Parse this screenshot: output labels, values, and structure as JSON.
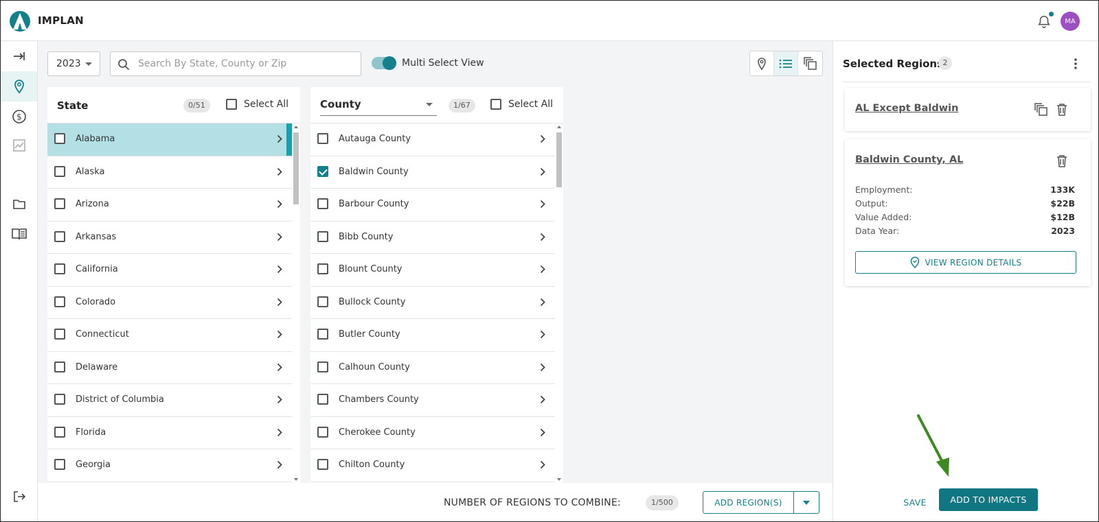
{
  "header": {
    "app_name": "IMPLAN",
    "avatar_initials": "MA"
  },
  "nav": {
    "items": [
      "expand-icon",
      "map-pin-icon",
      "dollar-icon",
      "chart-icon",
      "folder-icon",
      "book-icon",
      "logout-icon"
    ]
  },
  "toolbar": {
    "year": "2023",
    "search_placeholder": "Search By State, County or Zip",
    "multi_select_label": "Multi Select View",
    "multi_select_on": true
  },
  "state_panel": {
    "title": "State",
    "count": "0/51",
    "select_all": "Select All",
    "items": [
      "Alabama",
      "Alaska",
      "Arizona",
      "Arkansas",
      "California",
      "Colorado",
      "Connecticut",
      "Delaware",
      "District of Columbia",
      "Florida",
      "Georgia"
    ],
    "highlighted": "Alabama"
  },
  "county_panel": {
    "title": "County",
    "count": "1/67",
    "select_all": "Select All",
    "items": [
      "Autauga County",
      "Baldwin County",
      "Barbour County",
      "Bibb County",
      "Blount County",
      "Bullock County",
      "Butler County",
      "Calhoun County",
      "Chambers County",
      "Cherokee County",
      "Chilton County"
    ],
    "checked": [
      "Baldwin County"
    ]
  },
  "bottom": {
    "combine_label": "NUMBER OF REGIONS TO COMBINE:",
    "combine_count": "1/500",
    "add_regions": "ADD REGION(S)"
  },
  "selected_regions": {
    "title": "Selected Regions",
    "count": "2",
    "cards": [
      {
        "name": "AL Except Baldwin"
      },
      {
        "name": "Baldwin County, AL",
        "stats": [
          {
            "label": "Employment:",
            "value": "133K"
          },
          {
            "label": "Output:",
            "value": "$22B"
          },
          {
            "label": "Value Added:",
            "value": "$12B"
          },
          {
            "label": "Data Year:",
            "value": "2023"
          }
        ],
        "details_button": "VIEW REGION DETAILS"
      }
    ]
  },
  "actions": {
    "save": "SAVE",
    "add_to_impacts": "ADD TO IMPACTS"
  },
  "colors": {
    "accent": "#14808c",
    "highlight": "#b2e0e4",
    "avatar": "#9b4fc1",
    "arrow": "#3a8a1f"
  }
}
